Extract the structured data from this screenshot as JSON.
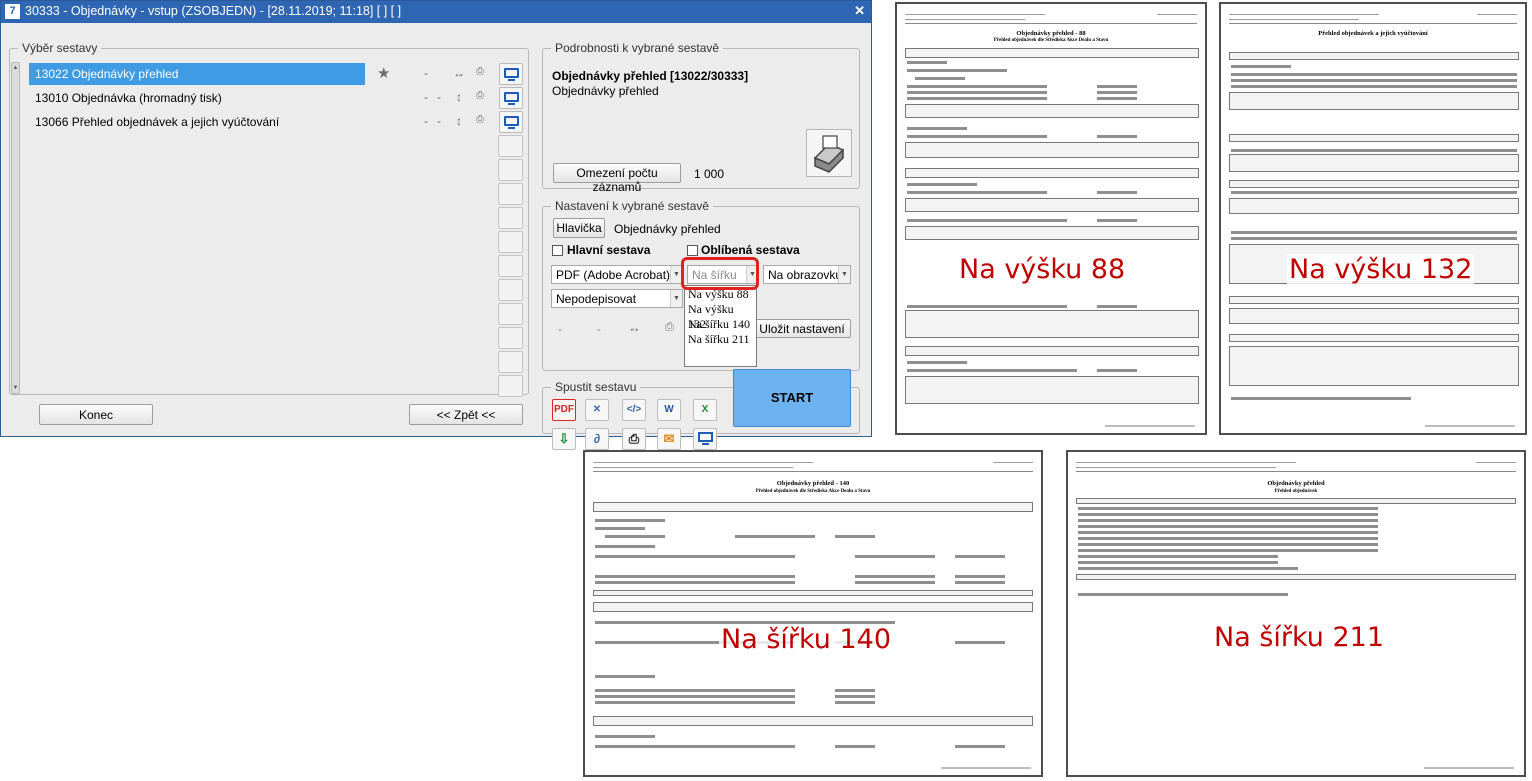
{
  "window": {
    "title": "30333 - Objednávky - vstup (ZSOBJEDN) - [28.11.2019; 11:18] [ ] [ ]",
    "app_icon": "7",
    "close_label": "✕"
  },
  "report_list": {
    "legend": "Výběr sestavy",
    "items": [
      {
        "code": "13022",
        "name": "Objednávky přehled",
        "selected": true,
        "favorite": true
      },
      {
        "code": "13010",
        "name": "Objednávka  (hromadný tisk)",
        "selected": false,
        "favorite": false
      },
      {
        "code": "13066",
        "name": "Přehled objednávek a jejich vyúčtování",
        "selected": false,
        "favorite": false
      }
    ],
    "item_labels": [
      "13022  Objednávky přehled",
      "13010  Objednávka  (hromadný tisk)",
      "13066  Přehled objednávek a jejich vyúčtování"
    ]
  },
  "details": {
    "legend": "Podrobnosti k vybrané sestavě",
    "report_title": "Objednávky přehled [13022/30333]",
    "report_desc": "Objednávky přehled",
    "limit_button": "Omezení počtu záznamů",
    "limit_value": "1 000"
  },
  "settings": {
    "legend": "Nastavení k vybrané sestavě",
    "header_button": "Hlavička",
    "header_value": "Objednávky přehled",
    "main_report_label": "Hlavní sestava",
    "favorite_label": "Oblíbená sestava",
    "format_value": "PDF (Adobe Acrobat)",
    "orientation_value": "Na šířku",
    "target_value": "Na obrazovku",
    "sign_value": "Nepodepisovat",
    "save_button": "Uložit nastavení",
    "orientation_options": [
      "Na výšku 88",
      "Na výšku 132",
      "Na šířku 140",
      "Na šířku 211"
    ]
  },
  "run": {
    "legend": "Spustit sestavu",
    "start_label": "START",
    "icons": [
      "pdf-icon",
      "scheduler-icon",
      "code-icon",
      "word-icon",
      "excel-icon",
      "download-icon",
      "attachment-icon",
      "print-icon",
      "email-icon",
      "screen-icon"
    ]
  },
  "footer": {
    "end_button": "Konec",
    "back_button": "<< Zpět <<"
  },
  "previews": [
    {
      "label": "Na výšku 88",
      "title": "Objednávky přehled - 88",
      "subtitle": "Přehled objednávek dle Střediska Akce Dealu a Stavu"
    },
    {
      "label": "Na výšku 132",
      "title": "Přehled objednávek a jejich vyúčtování",
      "subtitle": ""
    },
    {
      "label": "Na šířku 140",
      "title": "Objednávky přehled - 140",
      "subtitle": "Přehled objednávek dle Střediska Akce Dealu a Stavu"
    },
    {
      "label": "Na šířku 211",
      "title": "Objednávky přehled",
      "subtitle": "Přehled objednávek"
    }
  ],
  "colors": {
    "titlebar": "#2f66b3",
    "selection": "#3f9be4",
    "start": "#6db3f2",
    "highlight": "#e02222",
    "overlay_text": "#c00000"
  }
}
